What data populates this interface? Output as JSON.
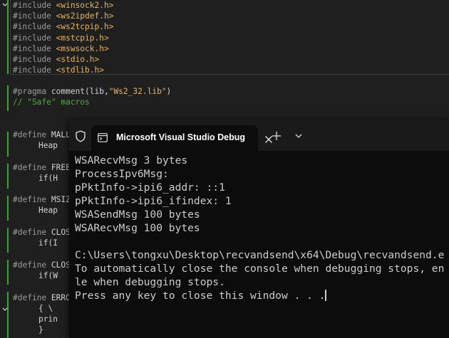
{
  "editor": {
    "lines": [
      {
        "kw": "#include",
        "rest": " <winsock2.h>"
      },
      {
        "kw": "#include",
        "rest": " <ws2ipdef.h>"
      },
      {
        "kw": "#include",
        "rest": " <ws2tcpip.h>"
      },
      {
        "kw": "#include",
        "rest": " <mstcpip.h>"
      },
      {
        "kw": "#include",
        "rest": " <mswsock.h>"
      },
      {
        "kw": "#include",
        "rest": " <stdio.h>"
      },
      {
        "kw": "#include",
        "rest": " <stdlib.h>"
      }
    ],
    "pragma": {
      "kw": "#pragma",
      "mid": " comment(lib,",
      "str": "\"Ws2_32.lib\"",
      "end": ")"
    },
    "comment": "// \"Safe\" macros",
    "defines": [
      {
        "kw": "#define",
        "name": " MALL",
        "cont": "Heap"
      },
      {
        "kw": "#define",
        "name": " FREE",
        "cont": "if(H"
      },
      {
        "kw": "#define",
        "name": " MSIZ",
        "cont": "Heap"
      },
      {
        "kw": "#define",
        "name": " CLOS",
        "cont": "if(I"
      },
      {
        "kw": "#define",
        "name": " CLOS",
        "cont": "if(W"
      },
      {
        "kw": "#define",
        "name": " ERRO",
        "cont": "{ \\"
      }
    ],
    "tail": [
      "prin",
      "}"
    ]
  },
  "terminal": {
    "tab_title": "Microsoft Visual Studio Debug",
    "output_lines": [
      "WSARecvMsg 3 bytes",
      "ProcessIpv6Msg:",
      "pPktInfo->ipi6_addr: ::1",
      "pPktInfo->ipi6_ifindex: 1",
      "WSASendMsg 100 bytes",
      "WSARecvMsg 100 bytes",
      "",
      "C:\\Users\\tongxu\\Desktop\\recvandsend\\x64\\Debug\\recvandsend.e",
      "To automatically close the console when debugging stops, en",
      "le when debugging stops.",
      "Press any key to close this window . . ."
    ]
  },
  "icons": {
    "shield": "shield-icon",
    "tab": "console-app-icon",
    "close": "close-icon",
    "new_tab": "plus-icon",
    "dropdown": "chevron-down-icon",
    "fold": "chevron-down-icon"
  },
  "colors": {
    "editor_bg": "#1f1f1f",
    "terminal_bg": "#0c0c0c",
    "include_path": "#e8b45a",
    "comment": "#57a64a",
    "change_bar": "#3aa63a"
  }
}
